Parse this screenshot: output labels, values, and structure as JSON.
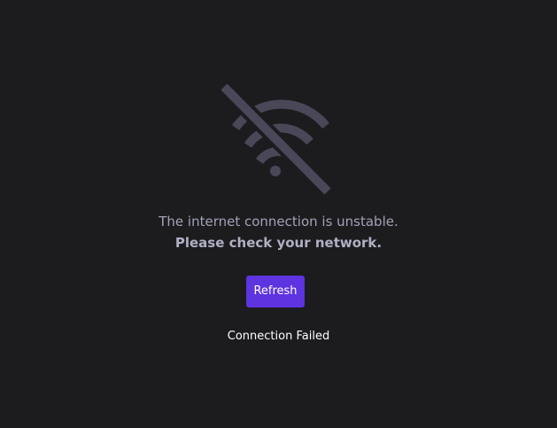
{
  "error_view": {
    "icon": "wifi-off-icon",
    "message_line_1": "The internet connection is unstable.",
    "message_line_2": "Please check your network.",
    "refresh_label": "Refresh",
    "status_text": "Connection Failed"
  },
  "colors": {
    "background": "#1c1c1f",
    "icon": "#4a4858",
    "message_text": "#a2a2b6",
    "button_bg": "#5e33e0",
    "button_text": "#ffffff",
    "status_text": "#ffffff"
  }
}
